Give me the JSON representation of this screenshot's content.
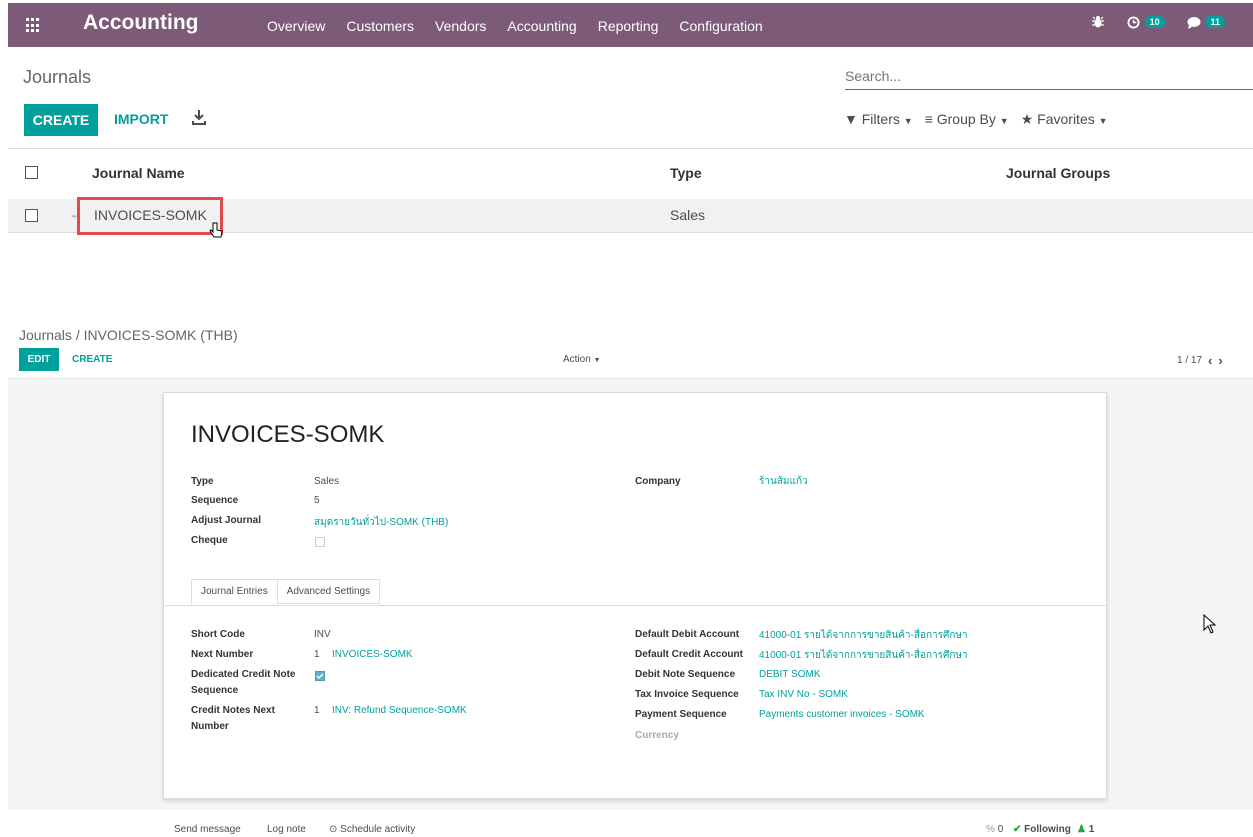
{
  "topbar": {
    "app_title": "Accounting",
    "nav": [
      "Overview",
      "Customers",
      "Vendors",
      "Accounting",
      "Reporting",
      "Configuration"
    ],
    "activity_count": "10",
    "messages_count": "11",
    "bar_color": "#7c5a78"
  },
  "list_view": {
    "title": "Journals",
    "search_placeholder": "Search...",
    "create_label": "CREATE",
    "import_label": "IMPORT",
    "filters_label": "Filters",
    "groupby_label": "Group By",
    "favorites_label": "Favorites",
    "columns": [
      "Journal Name",
      "Type",
      "Journal Groups"
    ],
    "rows": [
      {
        "name": "INVOICES-SOMK",
        "type": "Sales",
        "groups": ""
      }
    ]
  },
  "form_view": {
    "breadcrumb_parent": "Journals",
    "breadcrumb_sep": "/",
    "breadcrumb_current": "INVOICES-SOMK (THB)",
    "edit_label": "EDIT",
    "create_label": "CREATE",
    "action_label": "Action",
    "pager": "1 / 17",
    "title": "INVOICES-SOMK",
    "fields_left": [
      {
        "label": "Type",
        "value": "Sales"
      },
      {
        "label": "Sequence",
        "value": "5"
      },
      {
        "label": "Adjust Journal",
        "value": "สมุดรายวันทั่วไป-SOMK (THB)"
      },
      {
        "label": "Cheque",
        "value": ""
      }
    ],
    "company_label": "Company",
    "company_value": "ร้านส้มแก้ว",
    "tabs": [
      "Journal Entries",
      "Advanced Settings"
    ],
    "entries_left": {
      "short_code_label": "Short Code",
      "short_code_value": "INV",
      "next_number_label": "Next Number",
      "next_number_value": "1",
      "next_number_seq": "INVOICES-SOMK",
      "dedicated_label_1": "Dedicated Credit Note",
      "dedicated_label_2": "Sequence",
      "credit_next_label_1": "Credit Notes Next",
      "credit_next_label_2": "Number",
      "credit_next_value": "1",
      "credit_next_seq": "INV: Refund Sequence-SOMK"
    },
    "entries_right": [
      {
        "label": "Default Debit Account",
        "value": "41000-01 รายได้จากการขายสินค้า-สื่อการศึกษา"
      },
      {
        "label": "Default Credit Account",
        "value": "41000-01 รายได้จากการขายสินค้า-สื่อการศึกษา"
      },
      {
        "label": "Debit Note Sequence",
        "value": "DEBIT SOMK"
      },
      {
        "label": "Tax Invoice Sequence",
        "value": "Tax INV No - SOMK"
      },
      {
        "label": "Payment Sequence",
        "value": "Payments customer invoices - SOMK"
      },
      {
        "label": "Currency",
        "value": ""
      }
    ]
  },
  "chatter": {
    "send_message": "Send message",
    "log_note": "Log note",
    "schedule_activity": "Schedule activity",
    "attachments": "0",
    "following": "Following",
    "followers": "1"
  }
}
